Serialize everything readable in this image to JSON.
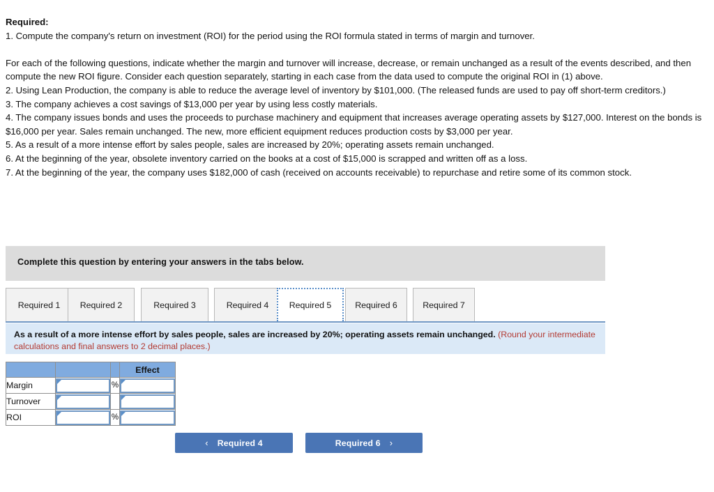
{
  "problem": {
    "heading": "Required:",
    "line1": "1. Compute the company's return on investment (ROI) for the period using the ROI formula stated in terms of margin and turnover.",
    "intro": "For each of the following questions, indicate whether the margin and turnover will increase, decrease, or remain unchanged as a result of the events described, and then compute the new ROI figure. Consider each question separately, starting in each case from the data used to compute the original ROI in (1) above.",
    "line2": "2. Using Lean Production, the company is able to reduce the average level of inventory by $101,000. (The released funds are used to pay off short-term creditors.)",
    "line3": "3. The company achieves a cost savings of $13,000 per year by using less costly materials.",
    "line4": "4. The company issues bonds and uses the proceeds to purchase machinery and equipment that increases average operating assets by $127,000. Interest on the bonds is $16,000 per year. Sales remain unchanged. The new, more efficient equipment reduces production costs by $3,000 per year.",
    "line5": "5. As a result of a more intense effort by sales people, sales are increased by 20%; operating assets remain unchanged.",
    "line6": "6. At the beginning of the year, obsolete inventory carried on the books at a cost of $15,000 is scrapped and written off as a loss.",
    "line7": "7. At the beginning of the year, the company uses $182,000 of cash (received on accounts receivable) to repurchase and retire some of its common stock."
  },
  "instruction_banner": {
    "text": "Complete this question by entering your answers in the tabs below."
  },
  "tabs": [
    {
      "label": "Required 1",
      "active": false
    },
    {
      "label": "Required 2",
      "active": false
    },
    {
      "label": "Required 3",
      "active": false
    },
    {
      "label": "Required 4",
      "active": false
    },
    {
      "label": "Required 5",
      "active": true
    },
    {
      "label": "Required 6",
      "active": false
    },
    {
      "label": "Required 7",
      "active": false
    }
  ],
  "question_banner": {
    "main": "As a result of a more intense effort by sales people, sales are increased by 20%; operating assets remain unchanged. ",
    "note": "(Round your intermediate calculations and final answers to 2 decimal places.)"
  },
  "answer_table": {
    "headers": [
      "",
      "",
      "",
      "Effect"
    ],
    "rows": [
      {
        "label": "Margin",
        "value": "",
        "unit": "%",
        "effect": ""
      },
      {
        "label": "Turnover",
        "value": "",
        "unit": "",
        "effect": ""
      },
      {
        "label": "ROI",
        "value": "",
        "unit": "%",
        "effect": ""
      }
    ]
  },
  "navigation": {
    "prev_label": "Required 4",
    "next_label": "Required 6",
    "prev_chevron": "‹",
    "next_chevron": "›"
  },
  "colors": {
    "button_blue": "#4a75b5",
    "table_header_blue": "#80abdf",
    "banner_gray": "#dcdcdc",
    "banner_blue": "#dbe9f7",
    "note_red": "#b33a32",
    "input_border": "#6f97c4"
  }
}
